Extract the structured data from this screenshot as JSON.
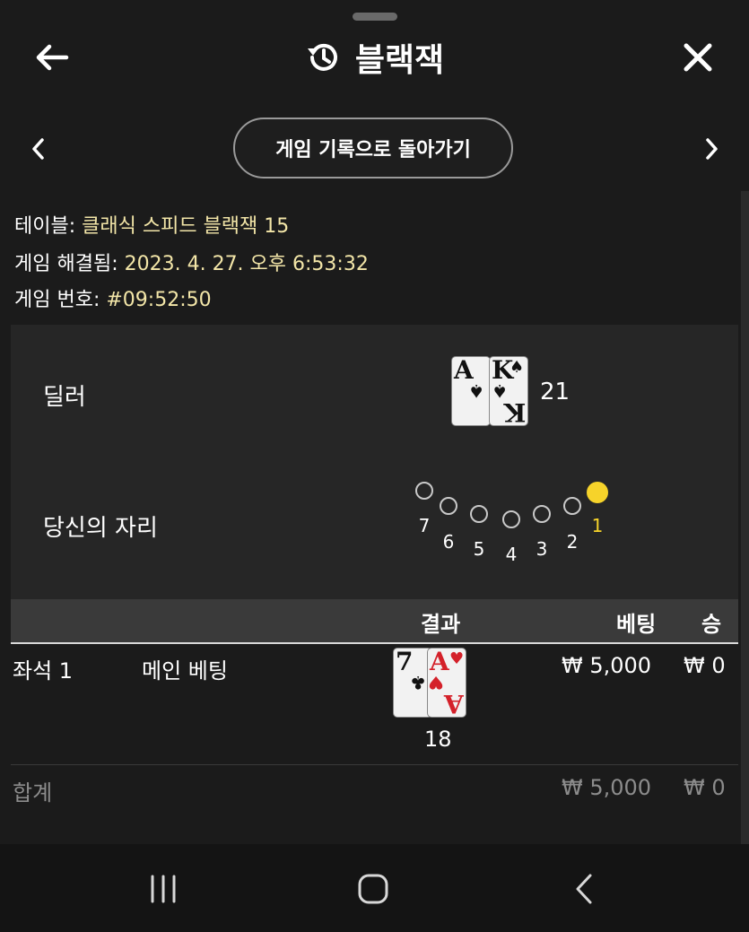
{
  "header": {
    "title": "블랙잭",
    "back_icon": "arrow-left-icon",
    "history_icon": "history-icon",
    "close_icon": "close-icon"
  },
  "nav": {
    "prev_icon": "chevron-left-icon",
    "next_icon": "chevron-right-icon",
    "back_to_history_label": "게임 기록으로 돌아가기"
  },
  "info": {
    "table_label": "테이블:",
    "table_value": "클래식 스피드 블랙잭 15",
    "resolved_label": "게임 해결됨:",
    "resolved_value": "2023. 4. 27. 오후 6:53:32",
    "number_label": "게임 번호:",
    "number_value": "#09:52:50"
  },
  "dealer": {
    "label": "딜러",
    "cards": [
      {
        "rank": "A",
        "suit": "♠",
        "color": "black"
      },
      {
        "rank": "K",
        "suit": "♠",
        "color": "black"
      }
    ],
    "total": "21"
  },
  "seats": {
    "label": "당신의 자리",
    "numbers": [
      "7",
      "6",
      "5",
      "4",
      "3",
      "2",
      "1"
    ],
    "active": "1",
    "active_color": "#f6d32a"
  },
  "results_table": {
    "headers": {
      "result": "결과",
      "bet": "베팅",
      "win": "승"
    },
    "rows": [
      {
        "seat": "좌석 1",
        "type": "메인 베팅",
        "cards": [
          {
            "rank": "7",
            "suit": "♣",
            "color": "black"
          },
          {
            "rank": "A",
            "suit": "♥",
            "color": "red"
          }
        ],
        "hand_total": "18",
        "bet": "₩ 5,000",
        "win": "₩ 0"
      }
    ],
    "total": {
      "label": "합계",
      "bet": "₩ 5,000",
      "win": "₩ 0"
    }
  },
  "system_nav": {
    "recents_icon": "recents-icon",
    "home_icon": "home-icon",
    "back_icon": "back-icon"
  }
}
